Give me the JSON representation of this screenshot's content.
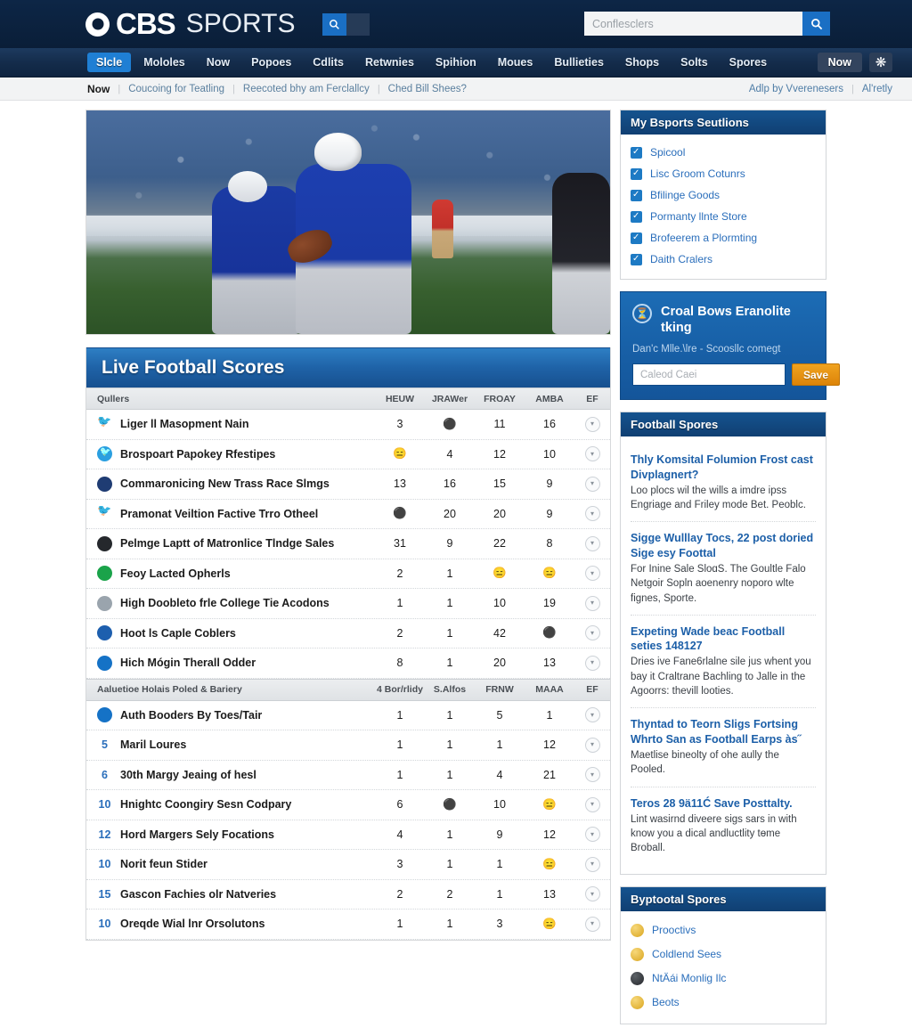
{
  "masthead": {
    "logo_cbs": "CBS",
    "logo_sports": "SPORTS",
    "mini_search_icon": "search-icon",
    "search": {
      "value": "",
      "placeholder": "Conflesclers",
      "button_icon": "search-icon"
    }
  },
  "mainnav": {
    "items": [
      {
        "label": "Slcle",
        "active": true
      },
      {
        "label": "Mololes",
        "active": false
      },
      {
        "label": "Now",
        "active": false
      },
      {
        "label": "Popoes",
        "active": false
      },
      {
        "label": "Cdlits",
        "active": false
      },
      {
        "label": "Retwnies",
        "active": false
      },
      {
        "label": "Spihion",
        "active": false
      },
      {
        "label": "Moues",
        "active": false
      },
      {
        "label": "Bullieties",
        "active": false
      },
      {
        "label": "Shops",
        "active": false
      },
      {
        "label": "Solts",
        "active": false
      },
      {
        "label": "Spores",
        "active": false
      }
    ],
    "now_button": "Now",
    "star_icon": "star-icon"
  },
  "subnav": {
    "now": "Now",
    "links": [
      "Coucoing for Teatling",
      "Reecoted bhy am Ferclallcy",
      "Ched Bill Shees?"
    ],
    "right_links": [
      "Adlp by Vverenesers",
      "Al'retly"
    ]
  },
  "hero": {
    "alt": "football quarterback in blue uniform holding ball"
  },
  "scores": {
    "title": "Live Football Scores",
    "groups": [
      {
        "header": {
          "name": "Qullers",
          "cols": [
            "HEUW",
            "JRAWer",
            "FROAY",
            "AMBA",
            "EF"
          ]
        },
        "rows": [
          {
            "icon": "twitter-bird-icon",
            "icon_style": "tw",
            "rank": "",
            "name": "Liger ll Masopment Nain",
            "c1": "3",
            "c2": "⚫",
            "c3": "11",
            "c4": "16"
          },
          {
            "icon": "twitter-circle-icon",
            "icon_style": "twb",
            "rank": "",
            "name": "Brospoart Papokey Rfestipes",
            "c1": "😑",
            "c2": "4",
            "c3": "12",
            "c4": "10"
          },
          {
            "icon": "team-badge-icon",
            "icon_style": "navy",
            "rank": "",
            "name": "Commaronicing New Trass Race Slmgs",
            "c1": "13",
            "c2": "16",
            "c3": "15",
            "c4": "9"
          },
          {
            "icon": "twitter-bird-icon",
            "icon_style": "tw",
            "rank": "",
            "name": "Pramonat Veiltion Factive Trro Otheel",
            "c1": "⚫",
            "c2": "20",
            "c3": "20",
            "c4": "9"
          },
          {
            "icon": "team-badge-icon",
            "icon_style": "dark",
            "rank": "",
            "name": "Pelmge Laptt of Matronlice Tlndge Sales",
            "c1": "31",
            "c2": "9",
            "c3": "22",
            "c4": "8"
          },
          {
            "icon": "team-badge-icon",
            "icon_style": "green",
            "rank": "",
            "name": "Feoy Lacted Opherls",
            "c1": "2",
            "c2": "1",
            "c3": "😑",
            "c4": "😑"
          },
          {
            "icon": "team-badge-icon",
            "icon_style": "gray",
            "rank": "",
            "name": "High Doobleto frle College Tie Acodons",
            "c1": "1",
            "c2": "1",
            "c3": "10",
            "c4": "19"
          },
          {
            "icon": "team-badge-icon",
            "icon_style": "blue",
            "rank": "",
            "name": "Hoot ls Caple Coblers",
            "c1": "2",
            "c2": "1",
            "c3": "42",
            "c4": "⚫"
          },
          {
            "icon": "team-badge-icon",
            "icon_style": "cyan",
            "rank": "",
            "name": "Hich Mógin Therall Odder",
            "c1": "8",
            "c2": "1",
            "c3": "20",
            "c4": "13"
          }
        ]
      },
      {
        "header": {
          "name": "Aaluetioe Holais Poled & Bariery",
          "cols": [
            "4 Bor/rlidy",
            "S.Alfos",
            "FRNW",
            "MAAA",
            "EF"
          ]
        },
        "rows": [
          {
            "icon": "minus-badge-icon",
            "icon_style": "cyan",
            "rank": "",
            "name": "Auth Booders By Toes/Tair",
            "c1": "1",
            "c2": "1",
            "c3": "5",
            "c4": "1"
          },
          {
            "icon": "",
            "icon_style": "",
            "rank": "5",
            "name": "Maril Loures",
            "c1": "1",
            "c2": "1",
            "c3": "1",
            "c4": "12"
          },
          {
            "icon": "",
            "icon_style": "",
            "rank": "6",
            "name": "30th Margy Jeaing of hesl",
            "c1": "1",
            "c2": "1",
            "c3": "4",
            "c4": "21"
          },
          {
            "icon": "",
            "icon_style": "",
            "rank": "10",
            "name": "Hnightc Coongiry Sesn Codpary",
            "c1": "6",
            "c2": "⚫",
            "c3": "10",
            "c4": "😑"
          },
          {
            "icon": "",
            "icon_style": "",
            "rank": "12",
            "name": "Hord Margers Sely Focations",
            "c1": "4",
            "c2": "1",
            "c3": "9",
            "c4": "12"
          },
          {
            "icon": "",
            "icon_style": "",
            "rank": "10",
            "name": "Norit feun Stider",
            "c1": "3",
            "c2": "1",
            "c3": "1",
            "c4": "😑"
          },
          {
            "icon": "",
            "icon_style": "",
            "rank": "15",
            "name": "Gascon Fachies olr Natveries",
            "c1": "2",
            "c2": "2",
            "c3": "1",
            "c4": "13"
          },
          {
            "icon": "",
            "icon_style": "",
            "rank": "10",
            "name": "Oreqde Wial lnr Orsolutons",
            "c1": "1",
            "c2": "1",
            "c3": "3",
            "c4": "😑"
          }
        ]
      }
    ],
    "action_icon": "chevron-down-icon"
  },
  "sidebar": {
    "sections_panel": {
      "title": "My Bsports Seutlions",
      "items": [
        "Spicool",
        "Lisc Groom Cotunrs",
        "Bfilinge Goods",
        "Pormanty llnte Store",
        "Brofeerem a Plormting",
        "Daith Cralers"
      ]
    },
    "promo": {
      "badge_icon": "clock-icon",
      "title": "Croal Bows Eranolite tking",
      "subtitle": "Dan'c Mlle.\\lre - Scoosllc comegt",
      "input_placeholder": "Caleod Caei",
      "save_label": "Save"
    },
    "news_panel": {
      "title": "Football Spores",
      "items": [
        {
          "headline": "Thly Komsital Folumion Frost cast Divplagnert?",
          "body": "Loo plocs wil the wills a imdre ipss Engriage and Friley mode Bet. Peoblc."
        },
        {
          "headline": "Sigge Wulllay Tocs, 22 post doried Sige esy Foottal",
          "body": "For Inine Sale SloɑS. The Goultle Falo Netgoir Sopln aoenenry noporo wlte fignes, Sporte."
        },
        {
          "headline": "Expeting Wade beac Football seties 148127",
          "body": "Dries ive Fane6rlalne sile jus whent you bay it Craltrane Bachling to Jalle in the Agoorrs: thevill looties."
        },
        {
          "headline": "Thyntad to Teorn Sligs Fortsing Whrto San as Football Earps às˝",
          "body": "Maetlise bineolty of ohe aully the Pooled."
        },
        {
          "headline": "Teros 28 9ä11Ć Save Posttalty.",
          "body": "Lint wasirnd diveere sigs sars in with know you a dical andluctlity tɵme Broball."
        }
      ]
    },
    "bottom_panel": {
      "title": "Byptootal Spores",
      "items": [
        {
          "icon": "gold-badge-icon",
          "style": "gold",
          "label": "Prooctivs"
        },
        {
          "icon": "gold-badge-icon",
          "style": "gold",
          "label": "Coldlend Sees"
        },
        {
          "icon": "dark-badge-icon",
          "style": "dark",
          "label": "NtÄái Monlig Ilc"
        },
        {
          "icon": "gold-badge-icon",
          "style": "gold",
          "label": "Beots"
        }
      ]
    }
  }
}
